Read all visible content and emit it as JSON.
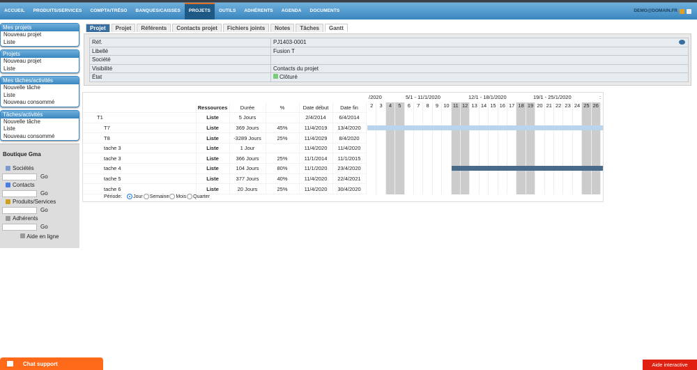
{
  "topnav": {
    "items": [
      "ACCUEIL",
      "PRODUITS/SERVICES",
      "COMPTA/TRÉSO",
      "BANQUES/CAISSES",
      "PROJETS",
      "OUTILS",
      "ADHÉRENTS",
      "AGENDA",
      "DOCUMENTS"
    ],
    "active": 4,
    "user": "DEMO@DOMAIN.FR"
  },
  "sidebar": {
    "blocks": [
      {
        "title": "Mes projets",
        "items": [
          "Nouveau projet",
          "Liste"
        ]
      },
      {
        "title": "Projets",
        "items": [
          "Nouveau projet",
          "Liste"
        ]
      },
      {
        "title": "Mes tâches/activités",
        "items": [
          "Nouvelle tâche",
          "Liste",
          "Nouveau consommé"
        ]
      },
      {
        "title": "Tâches/activités",
        "items": [
          "Nouvelle tâche",
          "Liste",
          "Nouveau consommé"
        ]
      }
    ],
    "shop": "Boutique Gma",
    "search": [
      {
        "label": "Sociétés",
        "go": "Go"
      },
      {
        "label": "Contacts",
        "go": "Go"
      },
      {
        "label": "Produits/Services",
        "go": "Go"
      },
      {
        "label": "Adhérents",
        "go": "Go"
      }
    ],
    "help": "Aide en ligne"
  },
  "tabs": [
    "Projet",
    "Projet",
    "Référents",
    "Contacts projet",
    "Fichiers joints",
    "Notes",
    "Tâches",
    "Gantt"
  ],
  "info": [
    [
      "Réf.",
      "PJ1403-0001"
    ],
    [
      "Libellé",
      "Fusion T"
    ],
    [
      "Société",
      ""
    ],
    [
      "Visibilité",
      "Contacts du projet"
    ],
    [
      "État",
      "Clôturé"
    ]
  ],
  "gantt": {
    "headers": [
      "",
      "Ressources",
      "Durée",
      "%",
      "Date début",
      "Date fin"
    ],
    "rows": [
      {
        "name": "T1",
        "res": "Liste",
        "dur": "5 Jours",
        "pct": "",
        "start": "2/4/2014",
        "end": "6/4/2014"
      },
      {
        "name": "T7",
        "res": "Liste",
        "dur": "369 Jours",
        "pct": "45%",
        "start": "11/4/2019",
        "end": "13/4/2020"
      },
      {
        "name": "T8",
        "res": "Liste",
        "dur": "-3289 Jours",
        "pct": "25%",
        "start": "11/4/2029",
        "end": "8/4/2020"
      },
      {
        "name": "tache 3",
        "res": "Liste",
        "dur": "1 Jour",
        "pct": "",
        "start": "11/4/2020",
        "end": "11/4/2020"
      },
      {
        "name": "tache 3",
        "res": "Liste",
        "dur": "366 Jours",
        "pct": "25%",
        "start": "11/1/2014",
        "end": "11/1/2015"
      },
      {
        "name": "tache 4",
        "res": "Liste",
        "dur": "104 Jours",
        "pct": "80%",
        "start": "11/1/2020",
        "end": "23/4/2020"
      },
      {
        "name": "tache 5",
        "res": "Liste",
        "dur": "377 Jours",
        "pct": "40%",
        "start": "11/4/2020",
        "end": "22/4/2021"
      },
      {
        "name": "tache 6",
        "res": "Liste",
        "dur": "20 Jours",
        "pct": "25%",
        "start": "11/4/2020",
        "end": "30/4/2020"
      }
    ],
    "weeks": [
      "/2020",
      "5/1 - 11/1/2020",
      "12/1 - 18/1/2020",
      "19/1 - 25/1/2020",
      ":"
    ],
    "days": [
      "2",
      "3",
      "4",
      "5",
      "6",
      "7",
      "8",
      "9",
      "10",
      "11",
      "12",
      "13",
      "14",
      "15",
      "16",
      "17",
      "18",
      "19",
      "20",
      "21",
      "22",
      "23",
      "24",
      "25",
      "26",
      "2"
    ],
    "weekend": [
      2,
      3,
      9,
      10,
      16,
      17,
      23,
      24
    ],
    "bars": [
      {
        "row": 1,
        "from": 0,
        "to": 26,
        "color": "#b8d4ee"
      },
      {
        "row": 5,
        "from": 9,
        "to": 26,
        "color": "#4a6a8a"
      }
    ],
    "period": {
      "label": "Période:",
      "options": [
        "Jour",
        "Semaine",
        "Mois",
        "Quarter"
      ],
      "selected": 0
    }
  },
  "footer": {
    "chat": "Chat support",
    "aide": "Aide interactive"
  }
}
